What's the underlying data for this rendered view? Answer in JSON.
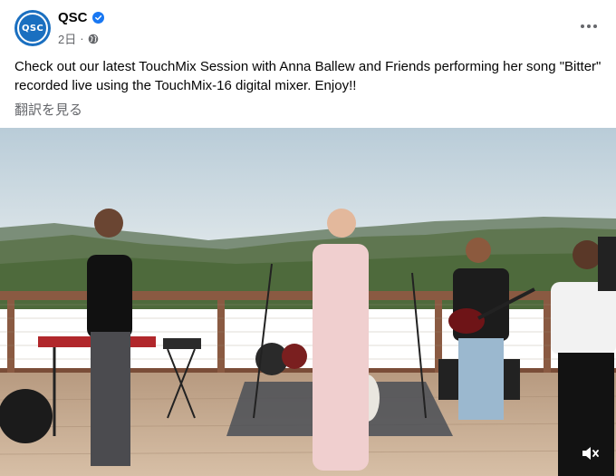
{
  "post": {
    "author": "QSC",
    "time": "2日",
    "separator": "·",
    "text": "Check out our latest TouchMix Session with Anna Ballew and Friends performing her song \"Bitter\" recorded live using the TouchMix-16 digital mixer. Enjoy!!",
    "translate_label": "翻訳を見る",
    "avatar_logo": "QSC"
  },
  "icons": {
    "verified": "verified-badge-icon",
    "audience": "globe-icon",
    "more": "more-options-icon",
    "mute": "speaker-muted-icon"
  },
  "colors": {
    "brand": "#1a6fc0",
    "verified": "#1877f2",
    "secondary_text": "#65676b"
  }
}
